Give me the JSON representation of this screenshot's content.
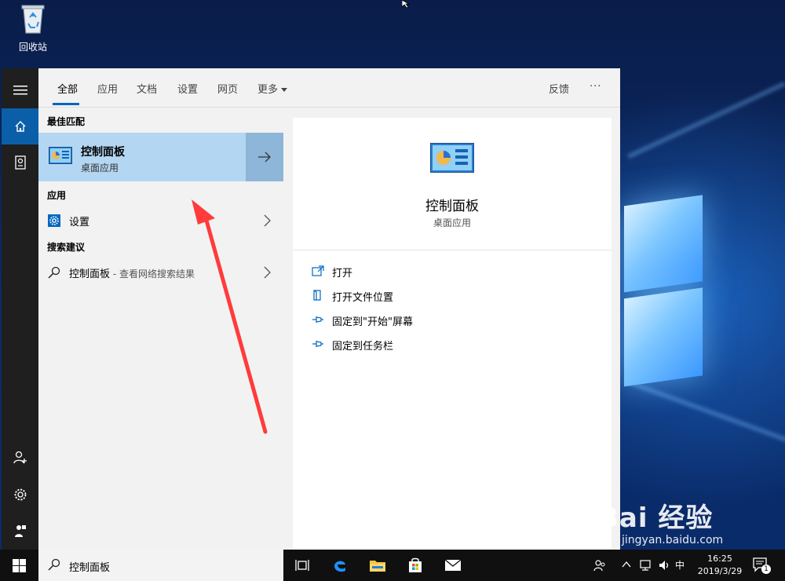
{
  "desktop": {
    "recycle_bin_label": "回收站"
  },
  "start_menu": {
    "tabs": [
      {
        "label": "全部",
        "active": true
      },
      {
        "label": "应用"
      },
      {
        "label": "文档"
      },
      {
        "label": "设置"
      },
      {
        "label": "网页"
      },
      {
        "label": "更多"
      }
    ],
    "feedback_label": "反馈",
    "more_options_label": "···",
    "sections": {
      "best_match": "最佳匹配",
      "apps": "应用",
      "search_suggestions": "搜索建议"
    },
    "best_match": {
      "title": "控制面板",
      "subtitle": "桌面应用"
    },
    "apps": [
      {
        "label": "设置"
      }
    ],
    "suggestions": [
      {
        "label": "控制面板",
        "hint": " - 查看网络搜索结果"
      }
    ],
    "preview": {
      "title": "控制面板",
      "subtitle": "桌面应用",
      "actions": [
        {
          "label": "打开",
          "icon": "open-icon"
        },
        {
          "label": "打开文件位置",
          "icon": "file-location-icon"
        },
        {
          "label": "固定到\"开始\"屏幕",
          "icon": "pin-icon"
        },
        {
          "label": "固定到任务栏",
          "icon": "pin-icon"
        }
      ]
    }
  },
  "taskbar": {
    "search_text": "控制面板",
    "ime_label": "中",
    "time": "16:25",
    "date": "2019/3/29",
    "notification_count": "1"
  },
  "watermark": {
    "logo_text": "Bai 经验",
    "url": "jingyan.baidu.com"
  },
  "colors": {
    "accent": "#0067c0",
    "selected_bg": "#b3d6f2",
    "rail_bg": "#1f1f1f",
    "annotation": "#ff3b3b"
  }
}
